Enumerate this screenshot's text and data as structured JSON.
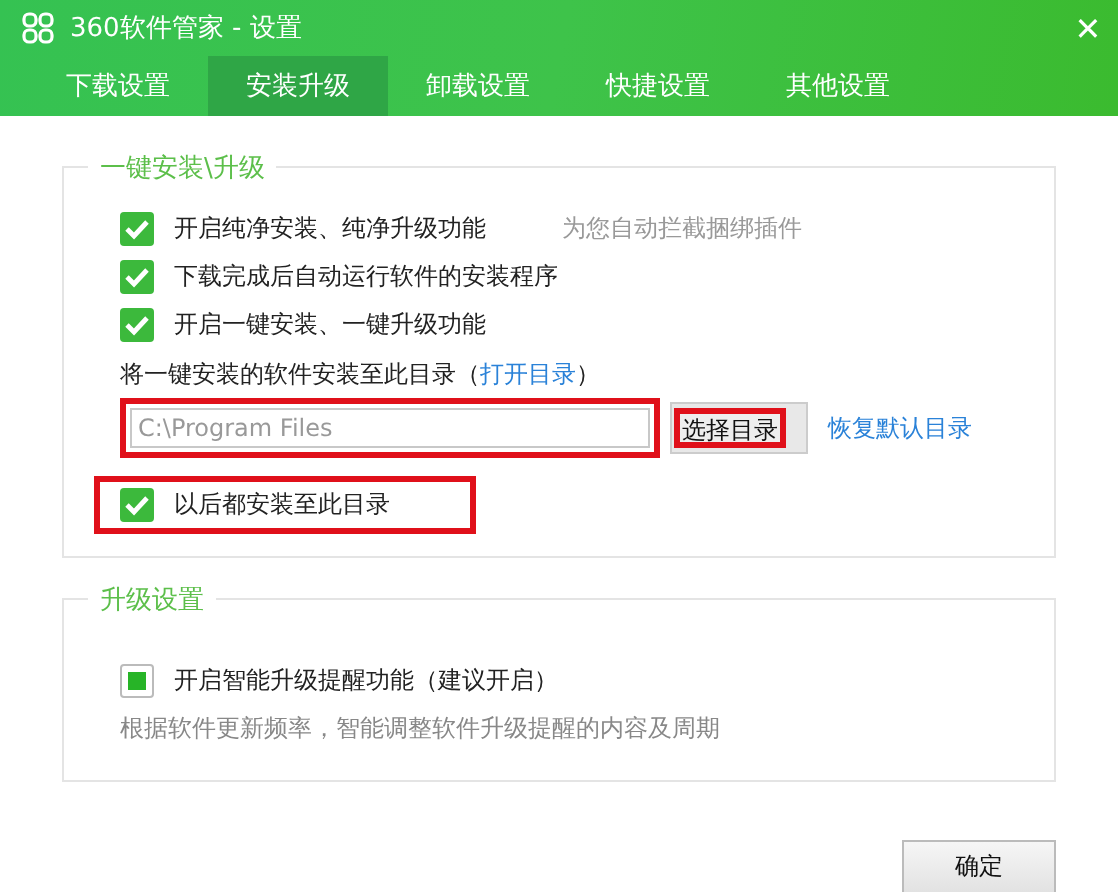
{
  "window": {
    "title": "360软件管家 - 设置",
    "close": "✕"
  },
  "tabs": [
    {
      "label": "下载设置",
      "selected": false
    },
    {
      "label": "安装升级",
      "selected": true
    },
    {
      "label": "卸载设置",
      "selected": false
    },
    {
      "label": "快捷设置",
      "selected": false
    },
    {
      "label": "其他设置",
      "selected": false
    }
  ],
  "install_group": {
    "title": "一键安装\\升级",
    "options": [
      {
        "label": "开启纯净安装、纯净升级功能",
        "hint": "为您自动拦截捆绑插件",
        "checked": true
      },
      {
        "label": "下载完成后自动运行软件的安装程序",
        "checked": true
      },
      {
        "label": "开启一键安装、一键升级功能",
        "checked": true
      }
    ],
    "directory_label": "将一键安装的软件安装至此目录（",
    "open_link": "打开目录",
    "directory_label_end": "）",
    "path_field": {
      "placeholder": "C:\\Program Files",
      "highlighted": true
    },
    "choose_button": {
      "label": "选择目录",
      "highlighted": true
    },
    "restore_link": "恢复默认目录",
    "remember_option": {
      "label": "以后都安装至此目录",
      "checked": true,
      "highlighted": true
    }
  },
  "upgrade_group": {
    "title": "升级设置",
    "option": {
      "label": "开启智能升级提醒功能（建议开启）",
      "checked": true
    },
    "description": "根据软件更新频率，智能调整软件升级提醒的内容及周期"
  },
  "ok_button": "确定"
}
